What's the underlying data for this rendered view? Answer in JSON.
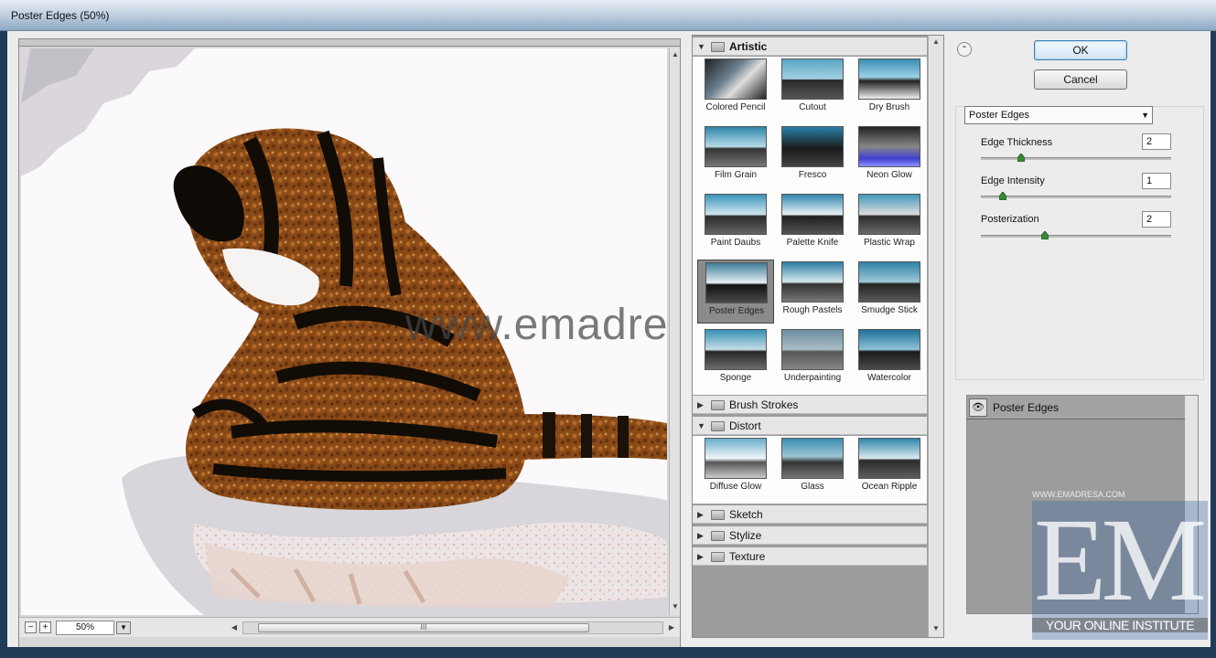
{
  "window": {
    "title": "Poster Edges (50%)"
  },
  "preview": {
    "zoom_value": "50%",
    "zoom_out_glyph": "−",
    "zoom_in_glyph": "+",
    "scroll_grip": "III"
  },
  "gallery": {
    "categories": [
      {
        "name": "Artistic",
        "expanded": true,
        "filters": [
          "Colored Pencil",
          "Cutout",
          "Dry Brush",
          "Film Grain",
          "Fresco",
          "Neon Glow",
          "Paint Daubs",
          "Palette Knife",
          "Plastic Wrap",
          "Poster Edges",
          "Rough Pastels",
          "Smudge Stick",
          "Sponge",
          "Underpainting",
          "Watercolor"
        ],
        "selected": "Poster Edges"
      },
      {
        "name": "Brush Strokes",
        "expanded": false
      },
      {
        "name": "Distort",
        "expanded": true,
        "filters": [
          "Diffuse Glow",
          "Glass",
          "Ocean Ripple"
        ]
      },
      {
        "name": "Sketch",
        "expanded": false
      },
      {
        "name": "Stylize",
        "expanded": false
      },
      {
        "name": "Texture",
        "expanded": false
      }
    ]
  },
  "buttons": {
    "ok": "OK",
    "cancel": "Cancel",
    "collapse_glyph": "⌃"
  },
  "settings": {
    "filter_selected": "Poster Edges",
    "params": [
      {
        "label": "Edge Thickness",
        "value": "2",
        "level": 0.2
      },
      {
        "label": "Edge Intensity",
        "value": "1",
        "level": 0.1
      },
      {
        "label": "Posterization",
        "value": "2",
        "level": 0.33
      }
    ]
  },
  "layers": {
    "items": [
      "Poster Edges"
    ]
  },
  "watermark": {
    "site": "www.emadresa.com",
    "logo_letters": "EM",
    "logo_tagline": "YOUR ONLINE INSTITUTE",
    "logo_url_small": "WWW.EMADRESA.COM"
  },
  "colors": {
    "ok_border": "#3c7fb1",
    "panel_bg": "#ececec",
    "gallery_bg": "#9c9c9c"
  }
}
